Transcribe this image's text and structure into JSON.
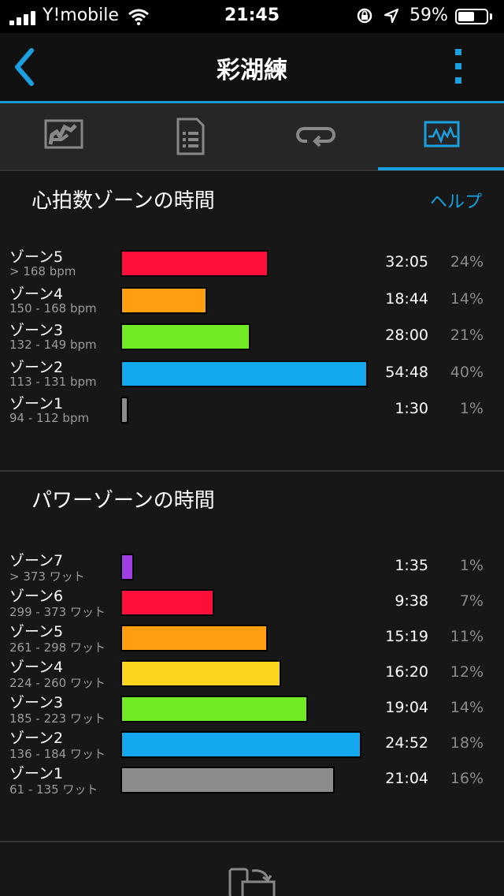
{
  "status_bar": {
    "carrier": "Y!mobile",
    "time": "21:45",
    "battery_text": "59%",
    "battery_level": 0.59
  },
  "nav": {
    "title": "彩湖練"
  },
  "tabs": [
    {
      "icon": "map-icon",
      "active": false
    },
    {
      "icon": "document-list-icon",
      "active": false
    },
    {
      "icon": "laps-loop-icon",
      "active": false
    },
    {
      "icon": "chart-pulse-icon",
      "active": true
    }
  ],
  "hr_section": {
    "title": "心拍数ゾーンの時間",
    "help_label": "ヘルプ",
    "zones": [
      {
        "name": "ゾーン5",
        "range": "> 168 bpm",
        "time": "32:05",
        "percent": "24%",
        "fraction": 0.24,
        "color": "#ff0f3a"
      },
      {
        "name": "ゾーン4",
        "range": "150 - 168 bpm",
        "time": "18:44",
        "percent": "14%",
        "fraction": 0.14,
        "color": "#ff9f10"
      },
      {
        "name": "ゾーン3",
        "range": "132 - 149 bpm",
        "time": "28:00",
        "percent": "21%",
        "fraction": 0.21,
        "color": "#6fea23"
      },
      {
        "name": "ゾーン2",
        "range": "113 - 131 bpm",
        "time": "54:48",
        "percent": "40%",
        "fraction": 0.4,
        "color": "#13a8ee"
      },
      {
        "name": "ゾーン1",
        "range": "94 - 112 bpm",
        "time": "1:30",
        "percent": "1%",
        "fraction": 0.01,
        "color": "#8c8c8c"
      }
    ]
  },
  "power_section": {
    "title": "パワーゾーンの時間",
    "zones": [
      {
        "name": "ゾーン7",
        "range": "> 373 ワット",
        "time": "1:35",
        "percent": "1%",
        "fraction": 0.01,
        "color": "#a03ee6"
      },
      {
        "name": "ゾーン6",
        "range": "299 - 373 ワット",
        "time": "9:38",
        "percent": "7%",
        "fraction": 0.07,
        "color": "#ff0f3a"
      },
      {
        "name": "ゾーン5",
        "range": "261 - 298 ワット",
        "time": "15:19",
        "percent": "11%",
        "fraction": 0.11,
        "color": "#ff9f10"
      },
      {
        "name": "ゾーン4",
        "range": "224 - 260 ワット",
        "time": "16:20",
        "percent": "12%",
        "fraction": 0.12,
        "color": "#fbd51e"
      },
      {
        "name": "ゾーン3",
        "range": "185 - 223 ワット",
        "time": "19:04",
        "percent": "14%",
        "fraction": 0.14,
        "color": "#6fea23"
      },
      {
        "name": "ゾーン2",
        "range": "136 - 184 ワット",
        "time": "24:52",
        "percent": "18%",
        "fraction": 0.18,
        "color": "#13a8ee"
      },
      {
        "name": "ゾーン1",
        "range": "61 - 135 ワット",
        "time": "21:04",
        "percent": "16%",
        "fraction": 0.16,
        "color": "#8c8c8c"
      }
    ]
  },
  "bottom": {
    "icon": "device-sync-icon"
  }
}
